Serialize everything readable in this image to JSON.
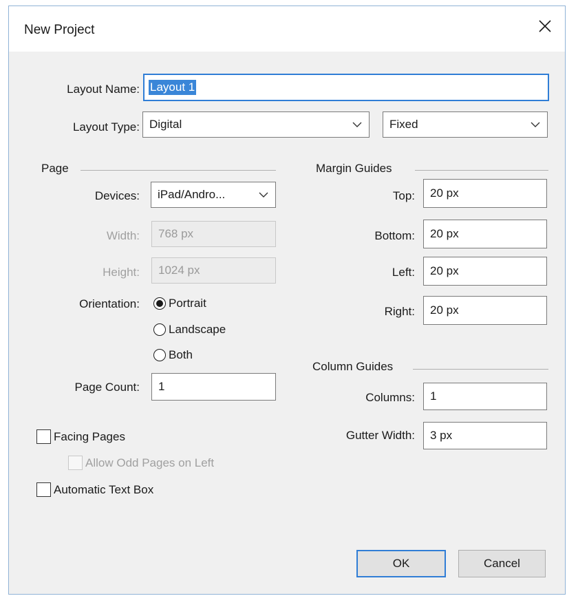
{
  "dialog": {
    "title": "New Project"
  },
  "icons": {
    "close": "close-icon",
    "dropdown": "chevron-down-icon"
  },
  "layout": {
    "name_label": "Layout Name:",
    "name_value": "Layout 1",
    "type_label": "Layout Type:",
    "type_value": "Digital",
    "mode_value": "Fixed"
  },
  "page": {
    "section": "Page",
    "devices_label": "Devices:",
    "devices_value": "iPad/Andro...",
    "width_label": "Width:",
    "width_value": "768 px",
    "height_label": "Height:",
    "height_value": "1024 px",
    "orientation_label": "Orientation:",
    "orientation_options": [
      "Portrait",
      "Landscape",
      "Both"
    ],
    "orientation_selected": "Portrait",
    "page_count_label": "Page Count:",
    "page_count_value": "1"
  },
  "margin_guides": {
    "section": "Margin Guides",
    "top_label": "Top:",
    "top_value": "20 px",
    "bottom_label": "Bottom:",
    "bottom_value": "20 px",
    "left_label": "Left:",
    "left_value": "20 px",
    "right_label": "Right:",
    "right_value": "20 px"
  },
  "column_guides": {
    "section": "Column Guides",
    "columns_label": "Columns:",
    "columns_value": "1",
    "gutter_label": "Gutter Width:",
    "gutter_value": "3 px"
  },
  "options": {
    "facing_pages": "Facing Pages",
    "facing_pages_checked": false,
    "allow_odd": "Allow Odd Pages on Left",
    "allow_odd_enabled": false,
    "auto_text_box": "Automatic Text Box",
    "auto_text_box_checked": false
  },
  "buttons": {
    "ok": "OK",
    "cancel": "Cancel"
  },
  "colors": {
    "accent": "#2f7dd6",
    "selection": "#3a86d8",
    "dialog_bg": "#f0f0f0"
  }
}
